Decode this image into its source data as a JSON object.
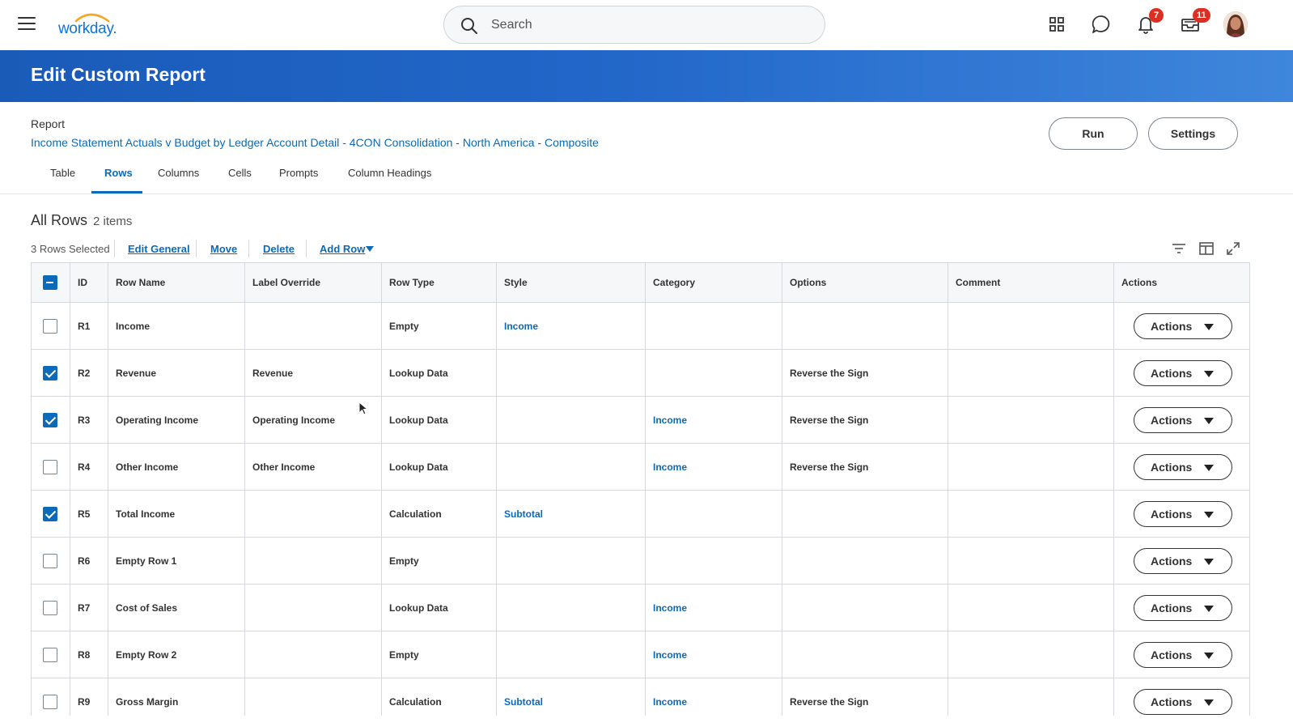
{
  "header": {
    "logo_text": "workday.",
    "search_placeholder": "Search",
    "notifications_count": "7",
    "inbox_count": "11"
  },
  "page": {
    "title": "Edit Custom Report",
    "report_label": "Report",
    "report_name": "Income Statement Actuals v Budget by Ledger Account Detail - 4CON Consolidation - North America - Composite",
    "run_label": "Run",
    "settings_label": "Settings"
  },
  "tabs": [
    {
      "label": "Table"
    },
    {
      "label": "Rows"
    },
    {
      "label": "Columns"
    },
    {
      "label": "Cells"
    },
    {
      "label": "Prompts"
    },
    {
      "label": "Column Headings"
    }
  ],
  "active_tab": "Rows",
  "section": {
    "title": "All Rows",
    "count": "2 items"
  },
  "toolbar": {
    "selected_text": "3 Rows Selected",
    "edit_general": "Edit General",
    "move": "Move",
    "delete": "Delete",
    "add_row": "Add Row"
  },
  "table": {
    "columns": [
      "ID",
      "Row Name",
      "Label Override",
      "Row Type",
      "Style",
      "Category",
      "Options",
      "Comment",
      "Actions"
    ],
    "actions_label": "Actions",
    "rows": [
      {
        "id": "R1",
        "row_name": "Income",
        "label_override": "",
        "row_type": "Empty",
        "style": "Income",
        "category": "",
        "options": "",
        "comment": "",
        "checked": false
      },
      {
        "id": "R2",
        "row_name": "Revenue",
        "label_override": "Revenue",
        "row_type": "Lookup Data",
        "style": "",
        "category": "",
        "options": "Reverse the Sign",
        "comment": "",
        "checked": true
      },
      {
        "id": "R3",
        "row_name": "Operating Income",
        "label_override": "Operating Income",
        "row_type": "Lookup Data",
        "style": "",
        "category": "Income",
        "options": "Reverse the Sign",
        "comment": "",
        "checked": true
      },
      {
        "id": "R4",
        "row_name": "Other Income",
        "label_override": "Other Income",
        "row_type": "Lookup Data",
        "style": "",
        "category": "Income",
        "options": "Reverse the Sign",
        "comment": "",
        "checked": false
      },
      {
        "id": "R5",
        "row_name": "Total Income",
        "label_override": "",
        "row_type": "Calculation",
        "style": "Subtotal",
        "category": "",
        "options": "",
        "comment": "",
        "checked": true
      },
      {
        "id": "R6",
        "row_name": "Empty Row 1",
        "label_override": "",
        "row_type": "Empty",
        "style": "",
        "category": "",
        "options": "",
        "comment": "",
        "checked": false
      },
      {
        "id": "R7",
        "row_name": "Cost of Sales",
        "label_override": "",
        "row_type": "Lookup Data",
        "style": "",
        "category": "Income",
        "options": "",
        "comment": "",
        "checked": false
      },
      {
        "id": "R8",
        "row_name": "Empty Row 2",
        "label_override": "",
        "row_type": "Empty",
        "style": "",
        "category": "Income",
        "options": "",
        "comment": "",
        "checked": false
      },
      {
        "id": "R9",
        "row_name": "Gross Margin",
        "label_override": "",
        "row_type": "Calculation",
        "style": "Subtotal",
        "category": "Income",
        "options": "Reverse the Sign",
        "comment": "",
        "checked": false
      }
    ]
  },
  "colors": {
    "brand_blue": "#0b6ab9",
    "banner_start": "#1a5bb8",
    "banner_end": "#3f86dc",
    "badge_red": "#de2e21"
  },
  "icons": [
    "hamburger-icon",
    "search-icon",
    "apps-icon",
    "chat-icon",
    "bell-icon",
    "inbox-icon",
    "filter-icon",
    "column-view-icon",
    "expand-icon"
  ]
}
